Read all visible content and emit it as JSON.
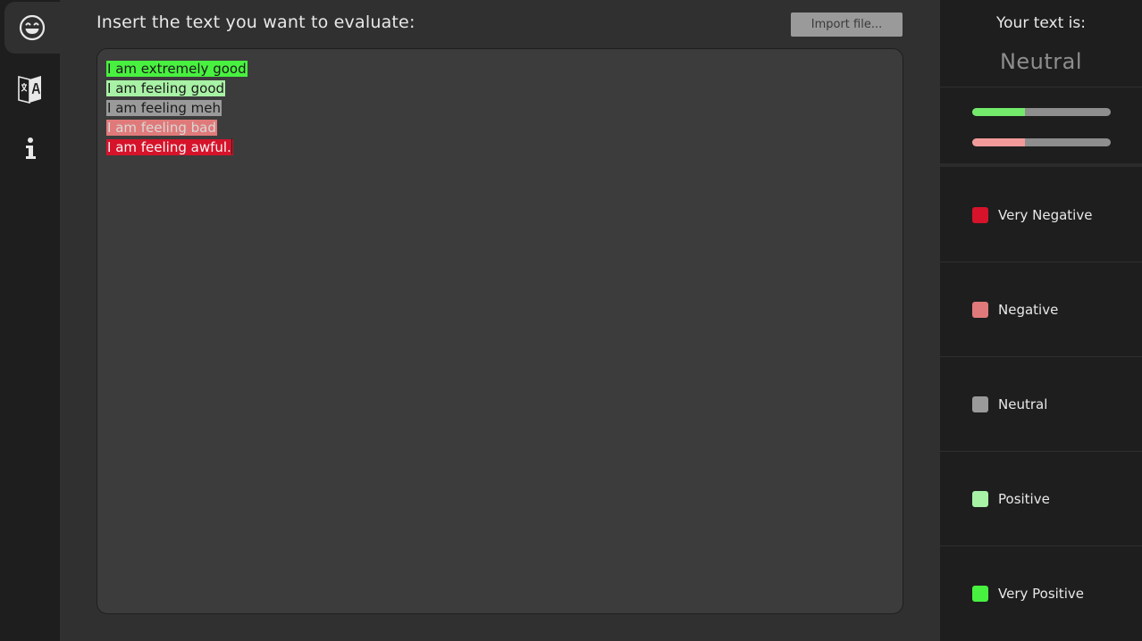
{
  "nav": {
    "items": [
      {
        "name": "sentiment",
        "icon": "grinning-face-icon",
        "active": true
      },
      {
        "name": "translate",
        "icon": "translate-icon",
        "active": false
      },
      {
        "name": "info",
        "icon": "info-icon",
        "active": false
      }
    ]
  },
  "header": {
    "title": "Insert the text you want to evaluate:",
    "import_label": "Import file..."
  },
  "editor": {
    "lines": [
      {
        "text": "I am extremely good",
        "sentiment": "very-positive"
      },
      {
        "text": "I am feeling good",
        "sentiment": "positive"
      },
      {
        "text": "I am feeling meh",
        "sentiment": "neutral"
      },
      {
        "text": "I am feeling bad",
        "sentiment": "negative"
      },
      {
        "text": "I am feeling awful.",
        "sentiment": "very-negative"
      }
    ]
  },
  "result": {
    "label": "Your text is:",
    "value": "Neutral",
    "positive_level": 0.38,
    "negative_level": 0.38
  },
  "legend": [
    {
      "label": "Very Negative",
      "color": "#d6132a"
    },
    {
      "label": "Negative",
      "color": "#e07a7a"
    },
    {
      "label": "Neutral",
      "color": "#9a9a9a"
    },
    {
      "label": "Positive",
      "color": "#a8f2a5"
    },
    {
      "label": "Very Positive",
      "color": "#48f13f"
    }
  ],
  "colors": {
    "positive_bar": "#73ea6c",
    "negative_bar": "#f29a9a"
  }
}
